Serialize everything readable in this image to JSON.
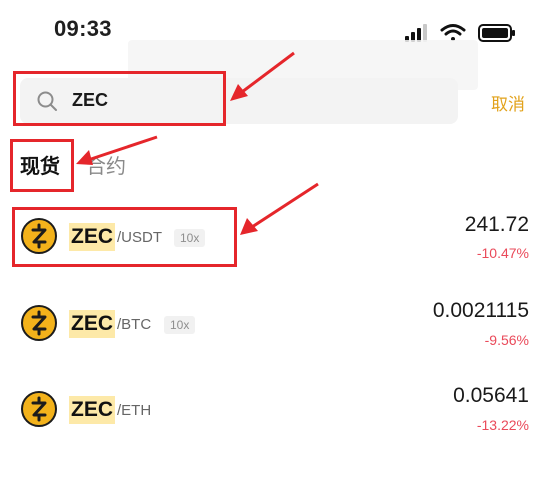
{
  "status_bar": {
    "time": "09:33"
  },
  "search": {
    "value": "ZEC",
    "cancel_label": "取消"
  },
  "tabs": [
    {
      "label": "现货",
      "active": true
    },
    {
      "label": "合约",
      "active": false
    }
  ],
  "results": [
    {
      "symbol": "ZEC",
      "pair": "/USDT",
      "leverage": "10x",
      "price": "241.72",
      "change": "-10.47%"
    },
    {
      "symbol": "ZEC",
      "pair": "/BTC",
      "leverage": "10x",
      "price": "0.0021115",
      "change": "-9.56%"
    },
    {
      "symbol": "ZEC",
      "pair": "/ETH",
      "leverage": "",
      "price": "0.05641",
      "change": "-13.22%"
    }
  ],
  "colors": {
    "accent": "#e2a21b",
    "negative": "#ea4a5a",
    "coin": "#f3b21b",
    "highlight": "#fde9a8",
    "annotation": "#e5262b"
  }
}
